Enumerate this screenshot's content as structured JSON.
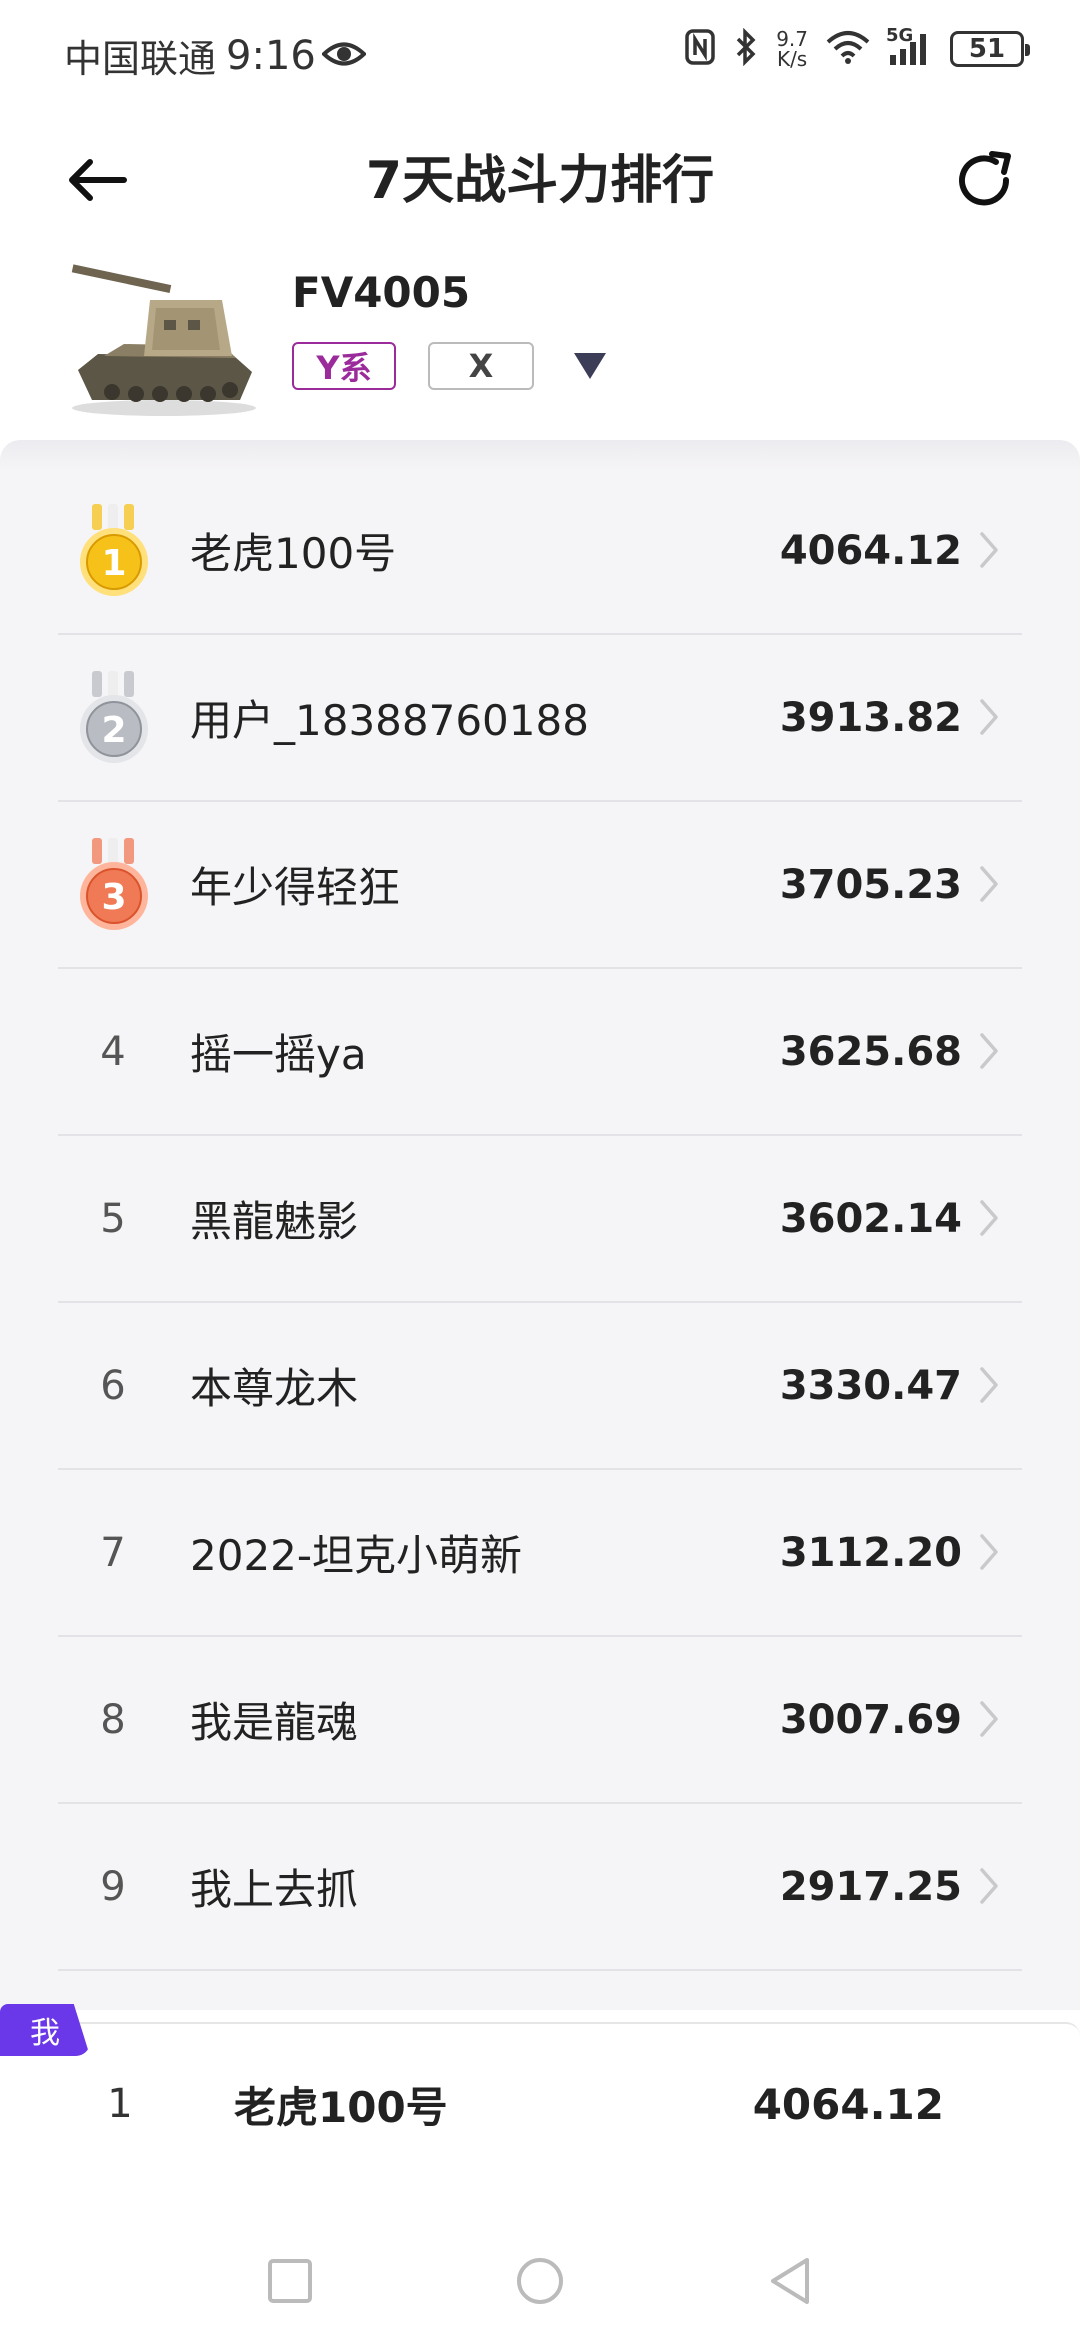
{
  "status_bar": {
    "carrier": "中国联通",
    "time": "9:16",
    "net_speed_top": "9.7",
    "net_speed_bottom": "K/s",
    "network": "5G",
    "battery": "51",
    "icons": [
      "eye-icon",
      "nfc-icon",
      "bluetooth-icon",
      "wifi-icon",
      "signal-icon",
      "battery-icon"
    ]
  },
  "header": {
    "title": "7天战斗力排行",
    "back_icon": "back-arrow-icon",
    "refresh_icon": "refresh-icon"
  },
  "vehicle": {
    "name": "FV4005",
    "tag_nation": "Y系",
    "tag_tier": "X",
    "dropdown_icon": "triangle-down-icon"
  },
  "ranking": [
    {
      "rank": "1",
      "name": "老虎100号",
      "score": "4064.12",
      "medal": "gold"
    },
    {
      "rank": "2",
      "name": "用户_18388760188",
      "score": "3913.82",
      "medal": "silver"
    },
    {
      "rank": "3",
      "name": "年少得轻狂",
      "score": "3705.23",
      "medal": "bronze"
    },
    {
      "rank": "4",
      "name": "摇一摇ya",
      "score": "3625.68"
    },
    {
      "rank": "5",
      "name": "黑龍魅影",
      "score": "3602.14"
    },
    {
      "rank": "6",
      "name": "本尊龙木",
      "score": "3330.47"
    },
    {
      "rank": "7",
      "name": "2022-坦克小萌新",
      "score": "3112.20"
    },
    {
      "rank": "8",
      "name": "我是龍魂",
      "score": "3007.69"
    },
    {
      "rank": "9",
      "name": "我上去抓",
      "score": "2917.25"
    }
  ],
  "my_rank": {
    "badge": "我",
    "rank": "1",
    "name": "老虎100号",
    "score": "4064.12"
  },
  "colors": {
    "accent_purple": "#6a38e8",
    "tag_magenta": "#9b2b9b",
    "gold": "#f6c21a",
    "silver": "#b9bcc2",
    "bronze": "#f07a55",
    "list_bg": "#f5f4f6"
  }
}
